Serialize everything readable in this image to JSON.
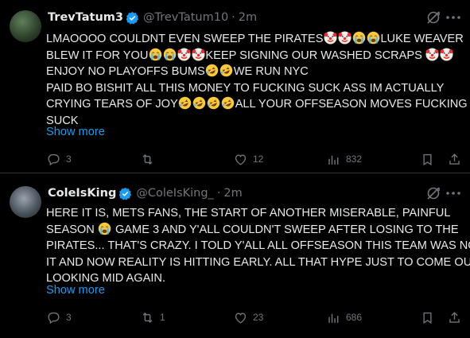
{
  "posts": [
    {
      "display_name": "TrevTatum3",
      "handle": "@TrevTatum10",
      "separator": "·",
      "time": "2m",
      "text_lines": [
        "LMAOOOO COULDNT EVEN SWEEP THE PIRATES",
        "LUKE WEAVER",
        "BLEW IT FOR YOU",
        "KEEP SIGNING OUR WASHED SCRAPS",
        "ENJOY NO PLAYOFFS BUMS",
        "WE RUN NYC",
        "PAID BO BISHIT ALL THIS MONEY TO FUCKING SUCK ASS IM ACTUALLY",
        "CRYING TEARS OF JOY",
        "ALL YOUR OFFSEASON MOVES FUCKING",
        "SUCK"
      ],
      "show_more": "Show more",
      "replies": "3",
      "reposts": "",
      "likes": "12",
      "views": "832"
    },
    {
      "display_name": "ColeIsKing",
      "handle": "@ColeIsKing_",
      "separator": "·",
      "time": "2m",
      "text_lines": [
        "HERE IT IS, METS FANS, THE START OF ANOTHER MISERABLE, PAINFUL",
        "SEASON",
        "GAME 3 AND Y'ALL COULDN'T SWEEP AFTER LOSING TO THE",
        "PIRATES... THAT'S CRAZY. I TOLD Y'ALL ALL OFFSEASON THIS TEAM WAS NOT",
        "IT AND NOW REALITY IS HITTING EARLY. ALL THAT HYPE JUST TO COME OUT",
        "LOOKING MID AGAIN."
      ],
      "show_more": "Show more",
      "replies": "3",
      "reposts": "1",
      "likes": "23",
      "views": "686"
    }
  ],
  "colors": {
    "background": "#000000",
    "text": "#e7e9ea",
    "muted": "#71767b",
    "link": "#1d9bf0",
    "verified": "#1d9bf0",
    "divider": "#2f3336"
  },
  "icons": [
    "verified-badge-icon",
    "grok-icon",
    "more-icon",
    "reply-icon",
    "repost-icon",
    "like-icon",
    "views-icon",
    "bookmark-icon",
    "share-icon",
    "clown-face-emoji",
    "loudly-crying-face-emoji",
    "rolling-on-floor-laughing-emoji"
  ]
}
